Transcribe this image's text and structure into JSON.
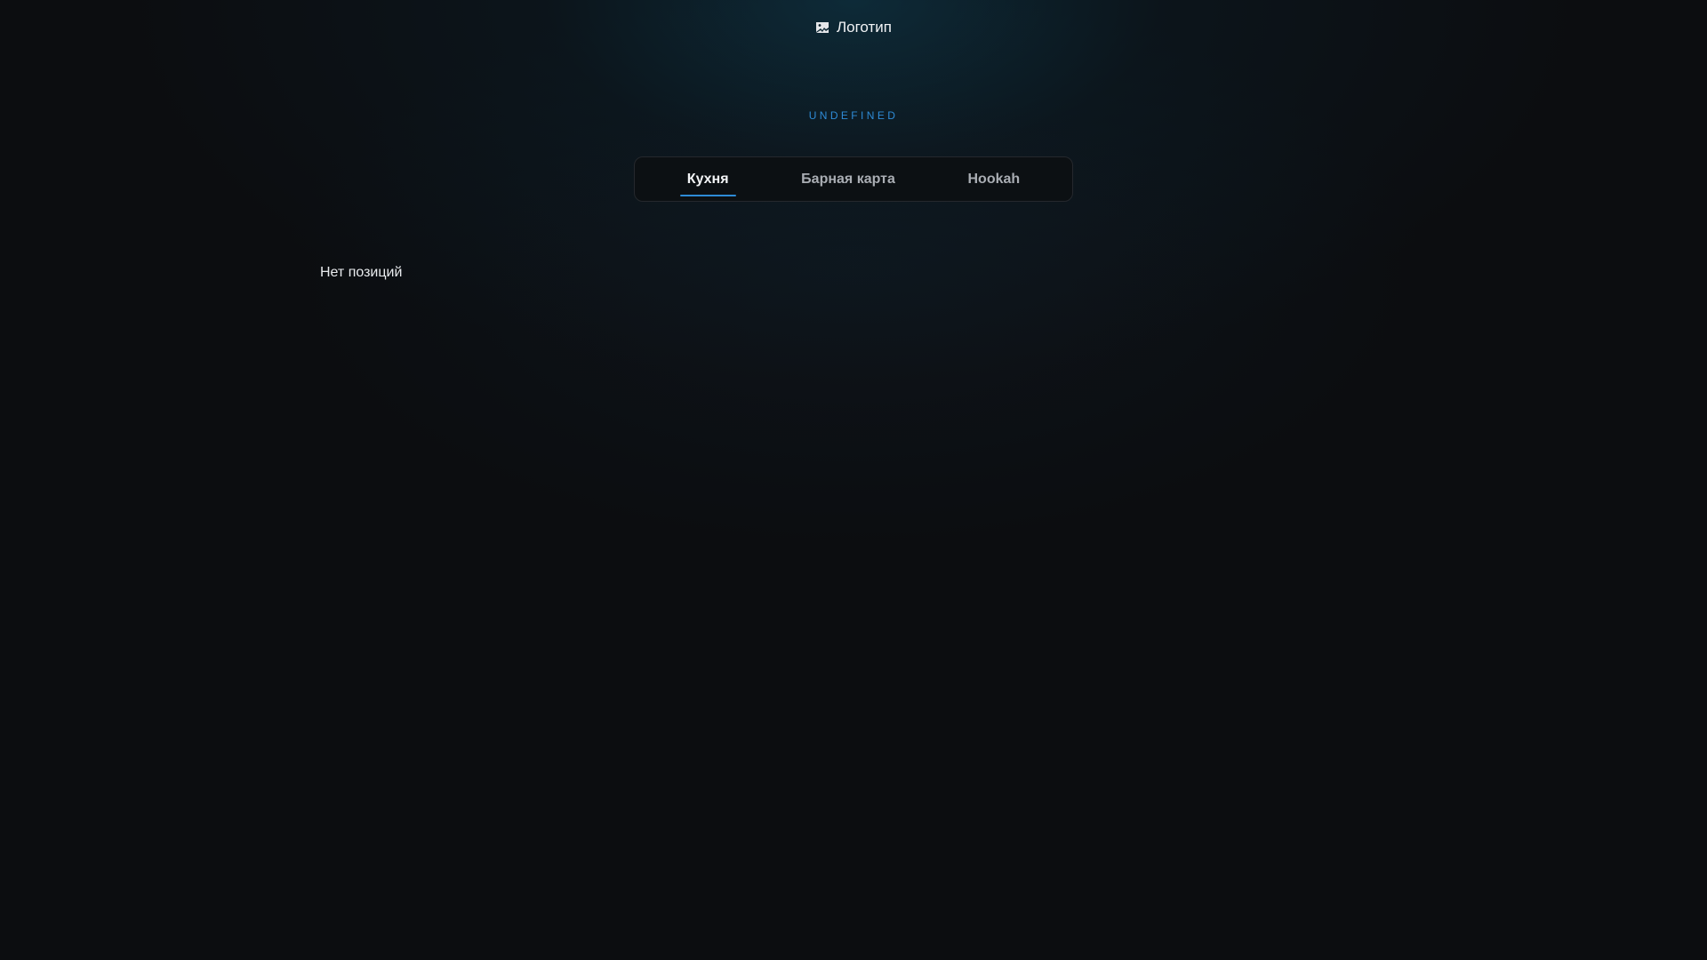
{
  "header": {
    "logo_alt": "Логотип",
    "logo_icon": "broken-image-icon",
    "venue_name": "UNDEFINED"
  },
  "tabs": [
    {
      "label": "Кухня",
      "active": true
    },
    {
      "label": "Барная карта",
      "active": false
    },
    {
      "label": "Hookah",
      "active": false
    }
  ],
  "menu": {
    "empty_message": "Нет позиций"
  },
  "colors": {
    "background": "#0c0d10",
    "accent": "#2e8bd6"
  }
}
